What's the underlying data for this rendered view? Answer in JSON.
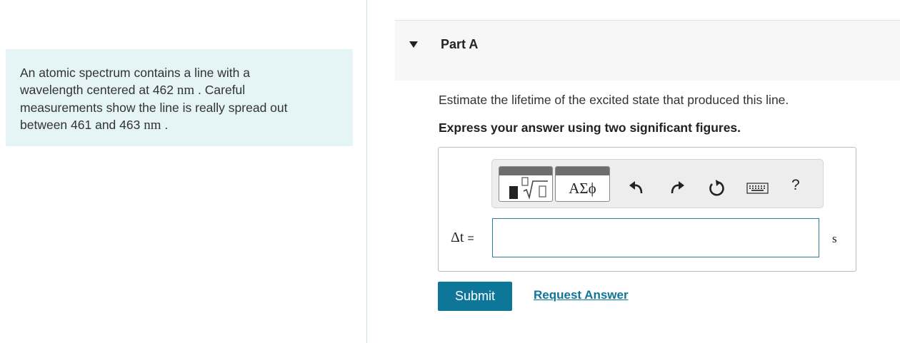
{
  "problem": {
    "line1": "An atomic spectrum contains a line with a",
    "line2_pre": "wavelength centered at 462 ",
    "line2_unit": "nm",
    "line2_post": " . Careful",
    "line3": "measurements show the line is really spread out",
    "line4_pre": "between 461 and 463 ",
    "line4_unit": "nm",
    "line4_post": " ."
  },
  "part": {
    "title": "Part A"
  },
  "question": {
    "instruction": "Estimate the lifetime of the excited state that produced this line.",
    "bold_instruction": "Express your answer using two significant figures."
  },
  "toolbar": {
    "symbols_label": "ΑΣϕ",
    "templates_glyph": "√",
    "help_label": "?",
    "icons": [
      "templates-icon",
      "greek-symbols-icon",
      "undo-icon",
      "redo-icon",
      "reset-icon",
      "keyboard-icon",
      "help-icon"
    ]
  },
  "answer": {
    "variable_label": "Δt",
    "equals": "=",
    "value": "",
    "unit": "s"
  },
  "actions": {
    "submit_label": "Submit",
    "request_label": "Request Answer"
  },
  "colors": {
    "accent": "#0e7698",
    "problem_bg": "#e5f4f4",
    "header_bg": "#f7f7f7"
  }
}
